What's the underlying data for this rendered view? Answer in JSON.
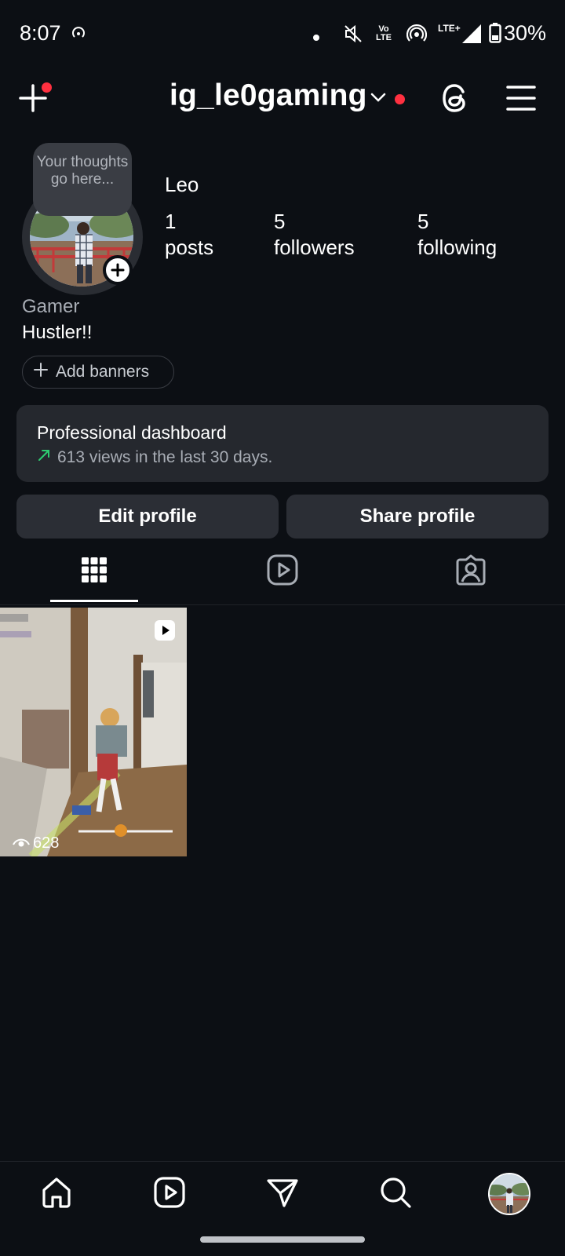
{
  "status_bar": {
    "time": "8:07",
    "network": "LTE+",
    "volte": "Vo LTE",
    "battery": "30%"
  },
  "header": {
    "username": "ig_le0gaming"
  },
  "profile": {
    "note": "Your thoughts go here...",
    "display_name": "Leo",
    "stats": [
      {
        "value": "1",
        "label": "posts"
      },
      {
        "value": "5",
        "label": "followers"
      },
      {
        "value": "5",
        "label": "following"
      }
    ],
    "category": "Gamer",
    "bio": "Hustler!!",
    "add_banners": "Add banners"
  },
  "dashboard": {
    "title": "Professional dashboard",
    "subtitle": "613 views in the last 30 days."
  },
  "buttons": {
    "edit": "Edit profile",
    "share": "Share profile"
  },
  "grid": {
    "items": [
      {
        "type": "reel",
        "views": "628"
      }
    ]
  },
  "colors": {
    "background": "#0c0f14",
    "notification_dot": "#ff3040",
    "trend_up": "#2ecc71"
  }
}
